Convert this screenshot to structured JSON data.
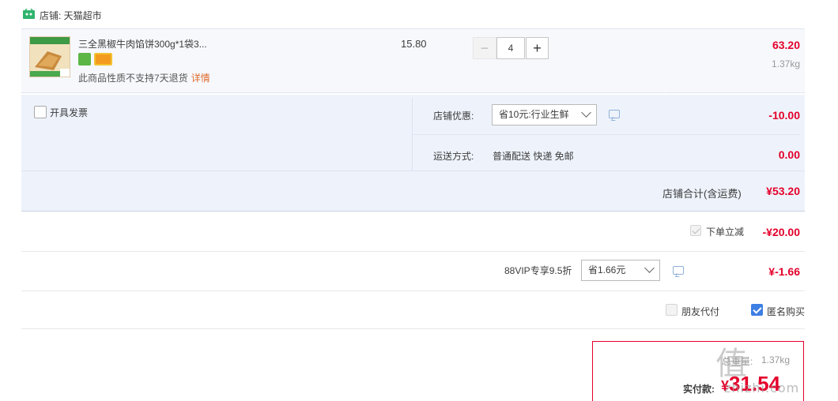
{
  "shop": {
    "icon": "tmall-shop-icon",
    "label": "店铺: 天猫超市"
  },
  "item": {
    "title": "三全黑椒牛肉馅饼300g*1袋3...",
    "note": "此商品性质不支持7天退货",
    "detail_link": "详情",
    "unit_price": "15.80",
    "quantity": "4",
    "minus": "−",
    "plus": "+",
    "line_total": "63.20",
    "weight": "1.37kg"
  },
  "invoice": {
    "label": "开具发票"
  },
  "promo": {
    "label": "店铺优惠:",
    "selected": "省10元:行业生鲜",
    "amount": "-10.00"
  },
  "shipping": {
    "label": "运送方式:",
    "value": "普通配送 快递 免邮",
    "amount": "0.00"
  },
  "shop_total": {
    "label": "店铺合计(含运费)",
    "amount": "¥53.20"
  },
  "instant_discount": {
    "label": "下单立减",
    "amount": "-¥20.00",
    "checked": true
  },
  "vip": {
    "label": "88VIP专享9.5折",
    "selected": "省1.66元",
    "amount": "¥-1.66"
  },
  "options": {
    "friend_pay": "朋友代付",
    "anonymous": "匿名购买",
    "anonymous_checked": true
  },
  "summary": {
    "weight_label": "总重量:",
    "weight_value": "1.37kg",
    "pay_label": "实付款:",
    "currency": "¥",
    "pay_amount": "31.54"
  },
  "watermark": {
    "mark": "值",
    "text": "zhizhi.com"
  },
  "colors": {
    "price_red": "#e4002b",
    "panel_bg": "#eef3fb",
    "checked_blue": "#3d7fe3",
    "link_orange": "#e06b2c"
  }
}
